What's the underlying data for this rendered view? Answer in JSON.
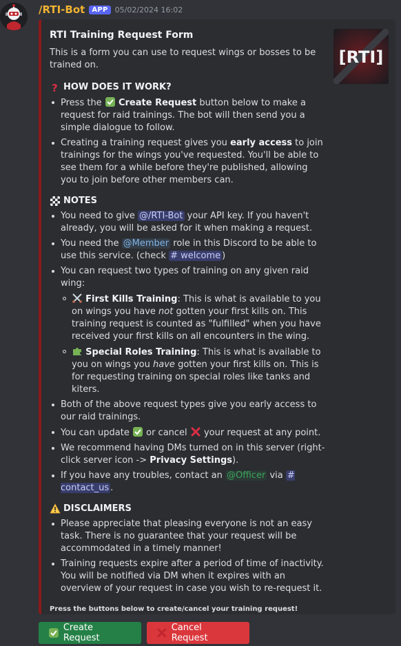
{
  "message": {
    "username": "/RTI-Bot",
    "app_badge": "APP",
    "timestamp": "05/02/2024 16:02"
  },
  "embed": {
    "accent_color": "#8b1a1a",
    "thumbnail_text": "[RTI]",
    "title": "RTI Training Request Form",
    "intro": "This is a form you can use to request wings or bosses to be trained on.",
    "how": {
      "title": "HOW DOES IT WORK?",
      "icon": "question-icon",
      "items": [
        {
          "pre": "Press the",
          "bold": "Create Request",
          "post": "button below to make a request for raid trainings. The bot will then send you a simple dialogue to follow."
        },
        {
          "pre": "Creating a training request gives you",
          "bold": "early access",
          "post": "to join trainings for the wings you've requested. You'll be able to see them for a while before they're published, allowing you to join before other members can."
        }
      ]
    },
    "notes": {
      "title": "NOTES",
      "icon": "checkered-flag-icon",
      "item1_pre": "You need to give",
      "item1_mention": "@/RTI-Bot",
      "item1_post": "your API key. If you haven't already, you will be asked for it when making a request.",
      "item2_pre": "You need the",
      "item2_mention": "@Member",
      "item2_mid": "role in this Discord to be able to use this service. (check",
      "item2_channel": "welcome",
      "item2_post": ")",
      "item3": "You can request two types of training on any given raid wing:",
      "sub1_bold": "First Kills Training",
      "sub1_pre": ": This is what is available to you on wings you have",
      "sub1_italic": "not",
      "sub1_post": "gotten your first kills on. This training request is counted as \"fulfilled\" when you have received your first kills on all encounters in the wing.",
      "sub2_bold": "Special Roles Training",
      "sub2_pre": ": This is what is available to you on wings you",
      "sub2_italic": "have",
      "sub2_post": "gotten your first kills on. This is for requesting training on special roles like tanks and kiters.",
      "item4": "Both of the above request types give you early access to our raid trainings.",
      "item5_pre": "You can update",
      "item5_mid": "or cancel",
      "item5_post": "your request at any point.",
      "item6_pre": "We recommend having DMs turned on in this server (right-click server icon ->",
      "item6_bold": "Privacy Settings",
      "item6_post": ").",
      "item7_pre": "If you have any troubles, contact an",
      "item7_mention": "@Officer",
      "item7_mid": "via",
      "item7_channel": "contact_us",
      "item7_post": "."
    },
    "disclaimers": {
      "title": "DISCLAIMERS",
      "icon": "warning-icon",
      "items": [
        "Please appreciate that pleasing everyone is not an easy task. There is no guarantee that your request will be accommodated in a timely manner!",
        "Training requests expire after a period of time of inactivity. You will be notified via DM when it expires with an overview of your request in case you wish to re-request it."
      ]
    },
    "footer": "Press the buttons below to create/cancel your training request!"
  },
  "buttons": {
    "create_label": "Create Request",
    "cancel_label": "Cancel Request",
    "create_color": "#248046",
    "cancel_color": "#da373c"
  }
}
